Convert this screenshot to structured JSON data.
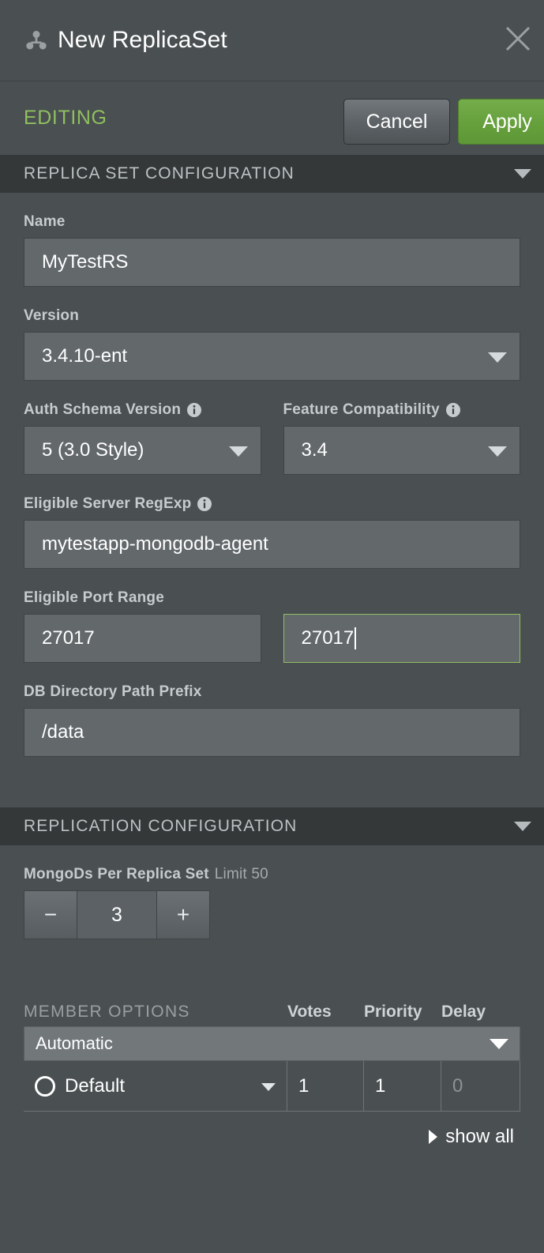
{
  "window": {
    "title": "New ReplicaSet",
    "icon": "replica-set-icon",
    "close_icon": "close-icon"
  },
  "actionbar": {
    "status": "EDITING",
    "cancel_label": "Cancel",
    "apply_label": "Apply"
  },
  "sections": {
    "replica_set_configuration": {
      "title": "REPLICA SET CONFIGURATION",
      "fields": {
        "name_label": "Name",
        "name_value": "MyTestRS",
        "version_label": "Version",
        "version_value": "3.4.10-ent",
        "auth_schema_label": "Auth Schema Version",
        "auth_schema_value": "5 (3.0 Style)",
        "feature_compat_label": "Feature Compatibility",
        "feature_compat_value": "3.4",
        "server_regexp_label": "Eligible Server RegExp",
        "server_regexp_value": "mytestapp-mongodb-agent",
        "port_range_label": "Eligible Port Range",
        "port_range_start": "27017",
        "port_range_end": "27017",
        "db_dir_label": "DB Directory Path Prefix",
        "db_dir_value": "/data"
      }
    },
    "replication_configuration": {
      "title": "REPLICATION CONFIGURATION",
      "mongods_label": "MongoDs Per Replica Set",
      "mongods_limit": "Limit 50",
      "mongods_value": "3",
      "decrement_label": "−",
      "increment_label": "+",
      "member_options": {
        "title": "MEMBER OPTIONS",
        "columns": [
          "Votes",
          "Priority",
          "Delay"
        ],
        "automatic_value": "Automatic",
        "rows": [
          {
            "name": "Default",
            "votes": "1",
            "priority": "1",
            "delay": "0"
          }
        ],
        "show_all_label": "show all"
      }
    }
  },
  "colors": {
    "panel_bg": "#4a4f51",
    "section_header_bg": "#343839",
    "input_bg": "#63686b",
    "accent_green": "#8fbf5f",
    "apply_green": "#66a03c",
    "focus_border": "#8fbf5f"
  }
}
